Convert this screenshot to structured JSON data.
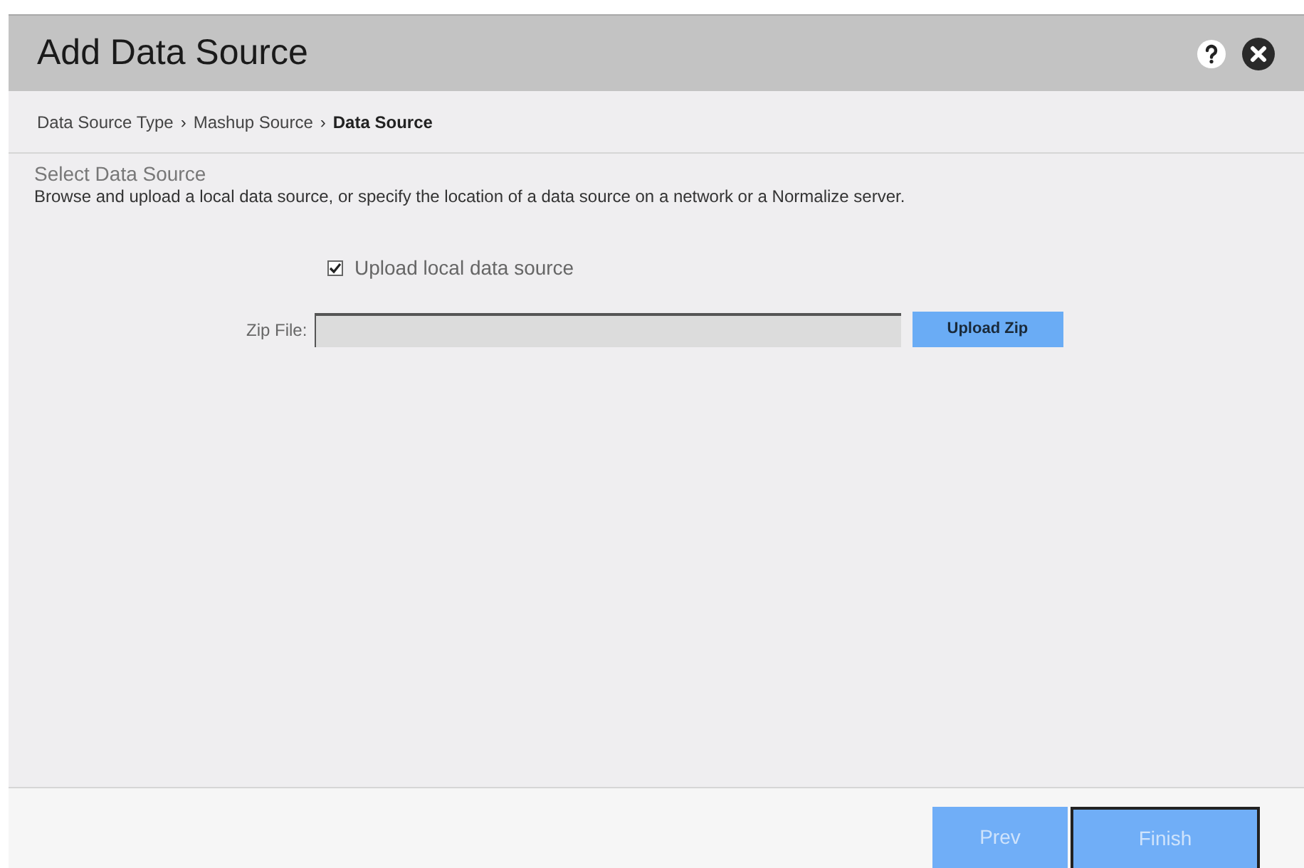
{
  "dialog": {
    "title": "Add Data Source"
  },
  "breadcrumb": [
    {
      "label": "Data Source Type",
      "selected": false
    },
    {
      "label": "Mashup Source",
      "selected": false
    },
    {
      "label": "Data Source",
      "selected": true
    }
  ],
  "breadcrumb_separator": "›",
  "section": {
    "title": "Select Data Source",
    "description": "Browse and upload a local data source, or specify the location of a data source on a network or a Normalize server."
  },
  "upload_checkbox": {
    "label": "Upload local data source",
    "checked": true
  },
  "zip_file": {
    "label": "Zip File:",
    "button": "Upload Zip"
  },
  "footer_buttons": [
    {
      "label": "Prev",
      "disabled": true,
      "focused": false
    },
    {
      "label": "Finish",
      "disabled": true,
      "focused": true
    }
  ]
}
